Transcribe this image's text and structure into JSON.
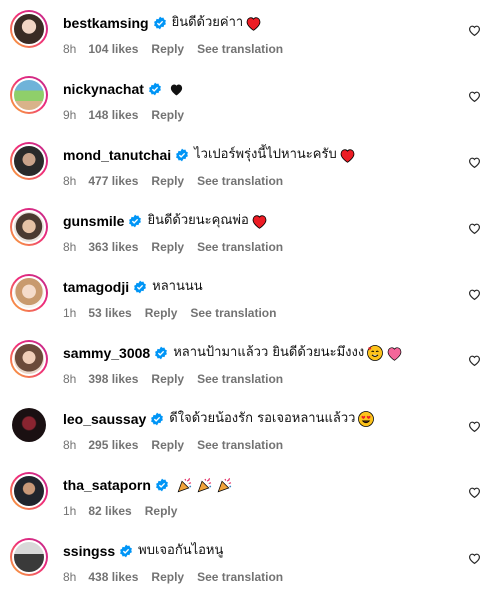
{
  "colors": {
    "verified": "#0095f6",
    "heart_red": "#ed1c24",
    "meta_gray": "#737373"
  },
  "comments": [
    {
      "username": "bestkamsing",
      "text": "ยินดีด้วยค่าา",
      "emoji": "red-heart",
      "time": "8h",
      "likes": "104 likes",
      "reply": "Reply",
      "translation": "See translation"
    },
    {
      "username": "nickynachat",
      "text": "",
      "emoji": "black-heart",
      "time": "9h",
      "likes": "148 likes",
      "reply": "Reply",
      "translation": ""
    },
    {
      "username": "mond_tanutchai",
      "text": "ไวเปอร์พรุ่งนี้ไปหานะครับ",
      "emoji": "red-heart",
      "time": "8h",
      "likes": "477 likes",
      "reply": "Reply",
      "translation": "See translation"
    },
    {
      "username": "gunsmile",
      "text": "ยินดีด้วยนะคุณพ่อ",
      "emoji": "red-heart",
      "time": "8h",
      "likes": "363 likes",
      "reply": "Reply",
      "translation": "See translation"
    },
    {
      "username": "tamagodji",
      "text": "หลานนน",
      "emoji": "",
      "time": "1h",
      "likes": "53 likes",
      "reply": "Reply",
      "translation": "See translation"
    },
    {
      "username": "sammy_3008",
      "text": "หลานป้ามาแล้วว ยินดีด้วยนะมึงงง",
      "emoji": "smiling-hearts-face, sparkling-heart",
      "time": "8h",
      "likes": "398 likes",
      "reply": "Reply",
      "translation": "See translation"
    },
    {
      "username": "leo_saussay",
      "text": "ดีใจด้วยน้องรัก รอเจอหลานแล้วว",
      "emoji": "heart-eyes-face",
      "time": "8h",
      "likes": "295 likes",
      "reply": "Reply",
      "translation": "See translation"
    },
    {
      "username": "tha_sataporn",
      "text": "",
      "emoji": "party-popper x3",
      "time": "1h",
      "likes": "82 likes",
      "reply": "Reply",
      "translation": ""
    },
    {
      "username": "ssingss",
      "text": "พบเจอกันไอหนู",
      "emoji": "",
      "time": "8h",
      "likes": "438 likes",
      "reply": "Reply",
      "translation": "See translation"
    }
  ]
}
